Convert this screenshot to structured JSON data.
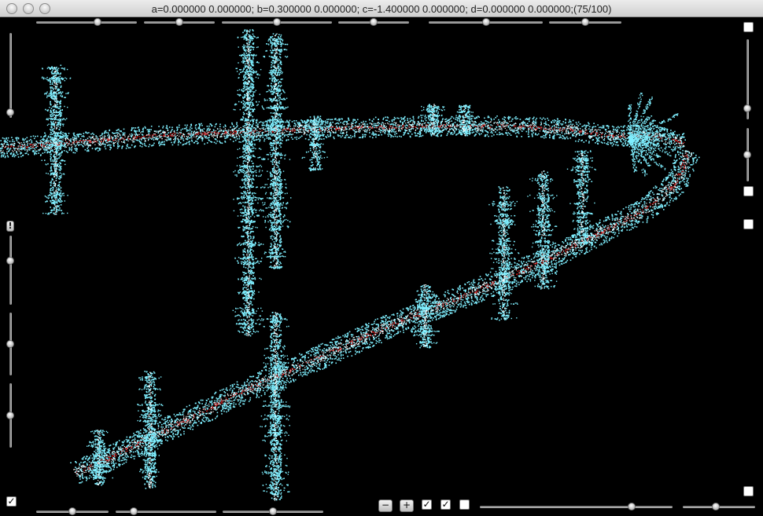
{
  "window": {
    "title": "a=0.000000 0.000000; b=0.300000 0.000000; c=-1.400000 0.000000; d=0.000000 0.000000;(75/100)"
  },
  "colors": {
    "background": "#000000",
    "fractal_primary": "#7fefff",
    "fractal_secondary": "#ffffff",
    "fractal_accent": "#d01818"
  },
  "controls": {
    "top_sliders": [
      0.62,
      0.5,
      0.5,
      0.5,
      0.5,
      0.5
    ],
    "left_sliders": [
      0.98,
      0.35,
      0.5,
      0.5
    ],
    "right_sliders": [
      0.9,
      0.5
    ],
    "bottom_left_sliders": [
      0.5,
      0.15,
      0.5
    ],
    "bottom_right_sliders": [
      0.8,
      0.45
    ],
    "buttons": {
      "minus": "−",
      "plus": "+",
      "alert": "!"
    },
    "checkboxes": {
      "bottom_left": true,
      "bottom_a": true,
      "bottom_b": true,
      "bottom_c": false,
      "right_top": false,
      "right_mid_a": false,
      "right_mid_b": false,
      "right_bottom": false
    },
    "check_mark": "✓"
  }
}
